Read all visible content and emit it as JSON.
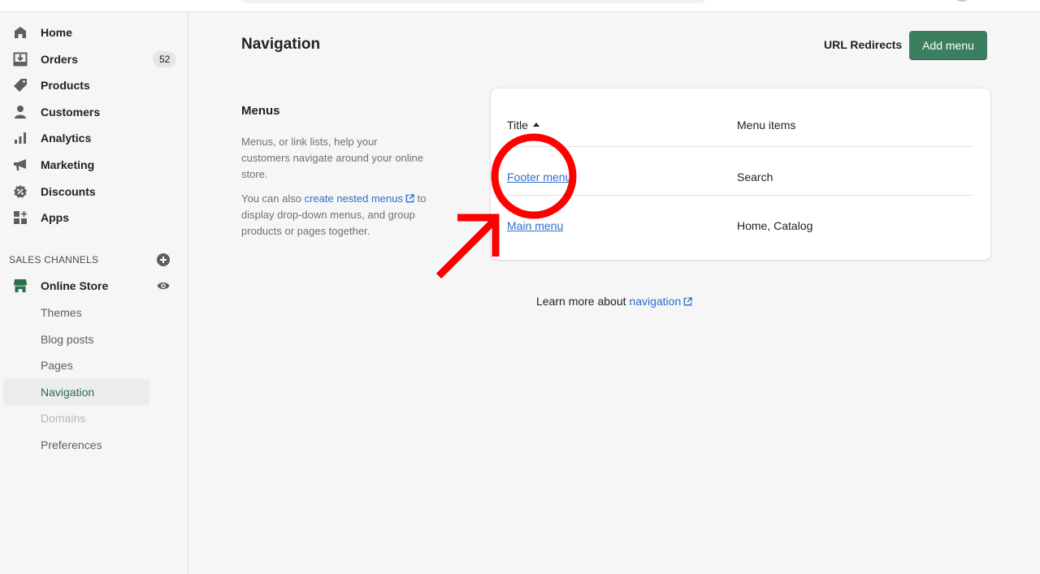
{
  "topbar": {
    "search_placeholder": ""
  },
  "sidebar": {
    "items": [
      {
        "label": "Home",
        "icon": "home-icon"
      },
      {
        "label": "Orders",
        "icon": "orders-icon",
        "badge": "52"
      },
      {
        "label": "Products",
        "icon": "tag-icon"
      },
      {
        "label": "Customers",
        "icon": "person-icon"
      },
      {
        "label": "Analytics",
        "icon": "bar-chart-icon"
      },
      {
        "label": "Marketing",
        "icon": "megaphone-icon"
      },
      {
        "label": "Discounts",
        "icon": "discount-icon"
      },
      {
        "label": "Apps",
        "icon": "apps-icon"
      }
    ],
    "sales_channels_label": "SALES CHANNELS",
    "online_store": {
      "label": "Online Store",
      "icon": "store-icon",
      "view_icon": "eye-icon"
    },
    "sub_items": [
      {
        "label": "Themes",
        "state": "normal"
      },
      {
        "label": "Blog posts",
        "state": "normal"
      },
      {
        "label": "Pages",
        "state": "normal"
      },
      {
        "label": "Navigation",
        "state": "active"
      },
      {
        "label": "Domains",
        "state": "disabled"
      },
      {
        "label": "Preferences",
        "state": "normal"
      }
    ]
  },
  "header": {
    "title": "Navigation",
    "url_redirects_label": "URL Redirects",
    "add_menu_label": "Add menu"
  },
  "annotation": {
    "title": "Menus",
    "description": "Menus, or link lists, help your customers navigate around your online store.",
    "nested_prefix": "You can also ",
    "nested_link": "create nested menus",
    "nested_suffix": " to display drop-down menus, and group products or pages together."
  },
  "table": {
    "columns": [
      "Title",
      "Menu items"
    ],
    "sort_indicator": "ascending",
    "rows": [
      {
        "title": "Footer menu",
        "items": "Search"
      },
      {
        "title": "Main menu",
        "items": "Home, Catalog"
      }
    ]
  },
  "footer": {
    "learn_prefix": "Learn more about ",
    "learn_link": "navigation"
  },
  "colors": {
    "primary": "#3b7f5f",
    "link": "#2c6ecb",
    "active_nav": "#2c6e49",
    "annotation_red": "#ff0000"
  }
}
